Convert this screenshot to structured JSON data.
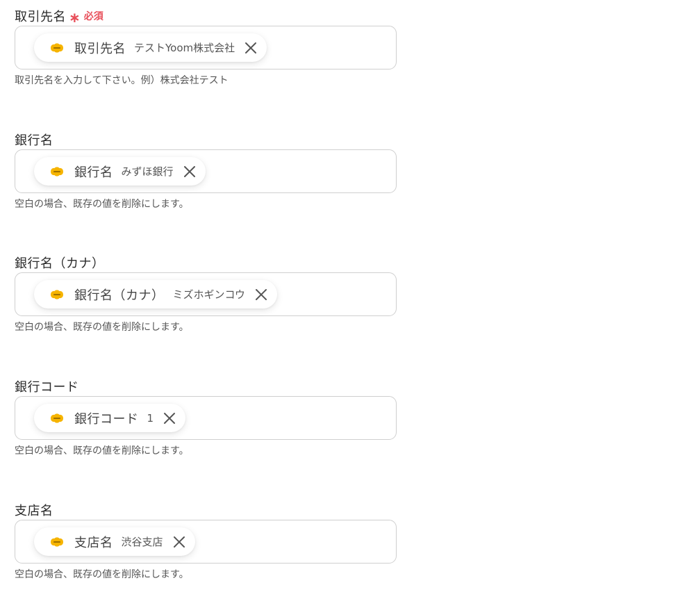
{
  "colors": {
    "required": "#e8505b",
    "chip_icon": "#f6b400",
    "border": "#cfcfcf"
  },
  "required_label": "必須",
  "chip_icon_name": "kintone-icon",
  "fields": [
    {
      "label": "取引先名",
      "required": true,
      "chip_name": "取引先名",
      "chip_value": "テストYoom株式会社",
      "help": "取引先名を入力して下さい。例）株式会社テスト"
    },
    {
      "label": "銀行名",
      "required": false,
      "chip_name": "銀行名",
      "chip_value": "みずほ銀行",
      "help": "空白の場合、既存の値を削除にします。"
    },
    {
      "label": "銀行名（カナ）",
      "required": false,
      "chip_name": "銀行名（カナ）",
      "chip_value": "ミズホギンコウ",
      "help": "空白の場合、既存の値を削除にします。"
    },
    {
      "label": "銀行コード",
      "required": false,
      "chip_name": "銀行コード",
      "chip_value": "1",
      "help": "空白の場合、既存の値を削除にします。"
    },
    {
      "label": "支店名",
      "required": false,
      "chip_name": "支店名",
      "chip_value": "渋谷支店",
      "help": "空白の場合、既存の値を削除にします。"
    }
  ]
}
